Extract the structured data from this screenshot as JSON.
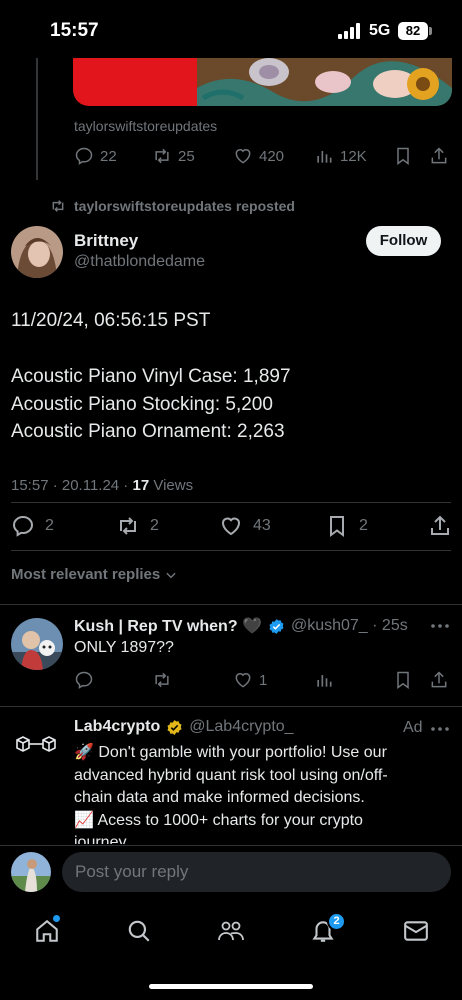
{
  "status_bar": {
    "time": "15:57",
    "network": "5G",
    "battery": "82"
  },
  "previous_post": {
    "handle_caption": "taylorswiftstoreupdates",
    "replies": "22",
    "reposts": "25",
    "likes": "420",
    "views": "12K"
  },
  "repost_banner": "taylorswiftstoreupdates reposted",
  "main_post": {
    "display_name": "Brittney",
    "handle": "@thatblondedame",
    "follow_label": "Follow",
    "text_line1": "11/20/24, 06:56:15 PST",
    "text_line2": "Acoustic Piano Vinyl Case: 1,897",
    "text_line3": "Acoustic Piano Stocking: 5,200",
    "text_line4": "Acoustic Piano Ornament: 2,263",
    "meta_time": "15:57 · 20.11.24 · ",
    "meta_views_count": "17",
    "meta_views_label": " Views",
    "replies": "2",
    "reposts": "2",
    "likes": "43",
    "bookmarks": "2"
  },
  "sort_label": "Most relevant replies",
  "reply": {
    "display_name": "Kush | Rep TV when? 🖤",
    "handle_time": "@kush07_ · 25s",
    "text": "ONLY 1897??",
    "likes": "1"
  },
  "ad": {
    "display_name": "Lab4crypto",
    "handle": "@Lab4crypto_",
    "ad_label": "Ad",
    "line1": "🚀 Don't gamble with your portfolio! Use our",
    "line2": "advanced hybrid quant risk tool using on/off-",
    "line3": "chain data and make informed decisions.",
    "line4": "📈 Acess to 1000+ charts for your crypto",
    "line5": "journey"
  },
  "composer": {
    "placeholder": "Post your reply"
  },
  "nav": {
    "notifications_badge": "2"
  },
  "colors": {
    "accent": "#1d9bf0",
    "verified_gold": "#e2b719",
    "background": "#000000",
    "muted": "#71767b"
  }
}
